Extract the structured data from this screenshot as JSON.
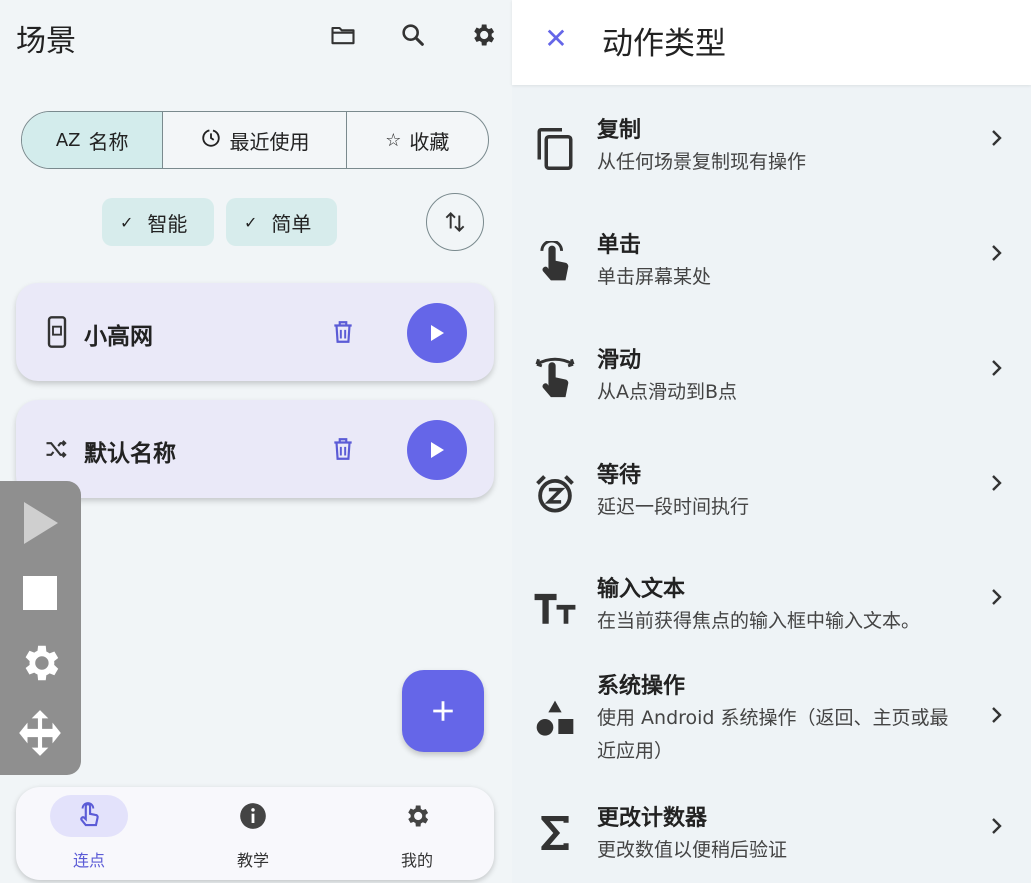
{
  "left": {
    "title": "场景",
    "tabs": [
      {
        "icon": "AZ",
        "label": "名称",
        "active": true
      },
      {
        "icon": "clock-icon",
        "label": "最近使用",
        "active": false
      },
      {
        "icon": "star-icon",
        "label": "收藏",
        "active": false
      }
    ],
    "chips": [
      "智能",
      "简单"
    ],
    "scenes": [
      {
        "name": "小高网",
        "icon": "phone-icon"
      },
      {
        "name": "默认名称",
        "icon": "shuffle-icon"
      }
    ],
    "nav": [
      {
        "label": "连点",
        "icon": "touch-icon",
        "active": true
      },
      {
        "label": "教学",
        "icon": "info-icon",
        "active": false
      },
      {
        "label": "我的",
        "icon": "gear-icon",
        "active": false
      }
    ]
  },
  "right": {
    "title": "动作类型",
    "items": [
      {
        "title": "复制",
        "subtitle": "从任何场景复制现有操作",
        "icon": "copy-icon"
      },
      {
        "title": "单击",
        "subtitle": "单击屏幕某处",
        "icon": "tap-icon"
      },
      {
        "title": "滑动",
        "subtitle": "从A点滑动到B点",
        "icon": "swipe-icon"
      },
      {
        "title": "等待",
        "subtitle": "延迟一段时间执行",
        "icon": "alarm-icon"
      },
      {
        "title": "输入文本",
        "subtitle": "在当前获得焦点的输入框中输入文本。",
        "icon": "text-icon"
      },
      {
        "title": "系统操作",
        "subtitle": "使用 Android 系统操作（返回、主页或最近应用）",
        "icon": "shapes-icon"
      },
      {
        "title": "更改计数器",
        "subtitle": "更改数值以便稍后验证",
        "icon": "sigma-icon"
      }
    ]
  },
  "colors": {
    "accent": "#6566e8",
    "chip": "#d7ecec",
    "card": "#eae9f8",
    "panel": "#8f8f8f"
  }
}
